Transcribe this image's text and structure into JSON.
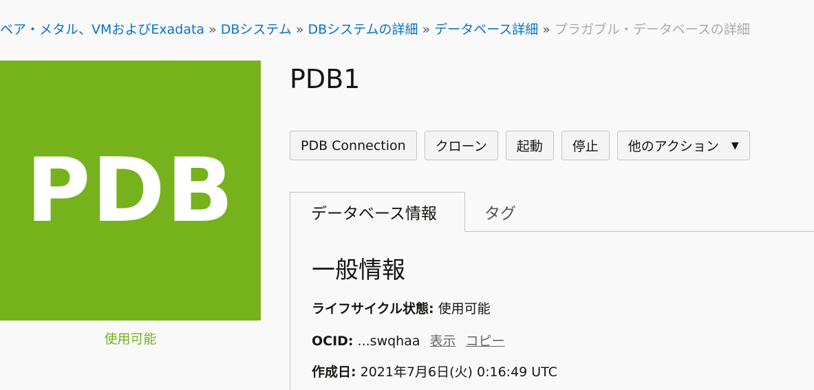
{
  "breadcrumb": {
    "items": [
      "ベア・メタル、VMおよびExadata",
      "DBシステム",
      "DBシステムの詳細",
      "データベース詳細"
    ],
    "separator": "»",
    "current": "プラガブル・データベースの詳細"
  },
  "tile": {
    "text": "PDB",
    "status": "使用可能",
    "color": "#76b21c"
  },
  "title": "PDB1",
  "actions": {
    "connection": "PDB Connection",
    "clone": "クローン",
    "start": "起動",
    "stop": "停止",
    "more": "他のアクション",
    "more_icon": "caret-down-icon"
  },
  "tabs": {
    "database_info": "データベース情報",
    "tags": "タグ"
  },
  "general": {
    "title": "一般情報",
    "lifecycle_label": "ライフサイクル状態:",
    "lifecycle_value": "使用可能",
    "ocid_label": "OCID:",
    "ocid_value": "...swqhaa",
    "ocid_show": "表示",
    "ocid_copy": "コピー",
    "created_label": "作成日:",
    "created_value": "2021年7月6日(火) 0:16:49 UTC"
  }
}
